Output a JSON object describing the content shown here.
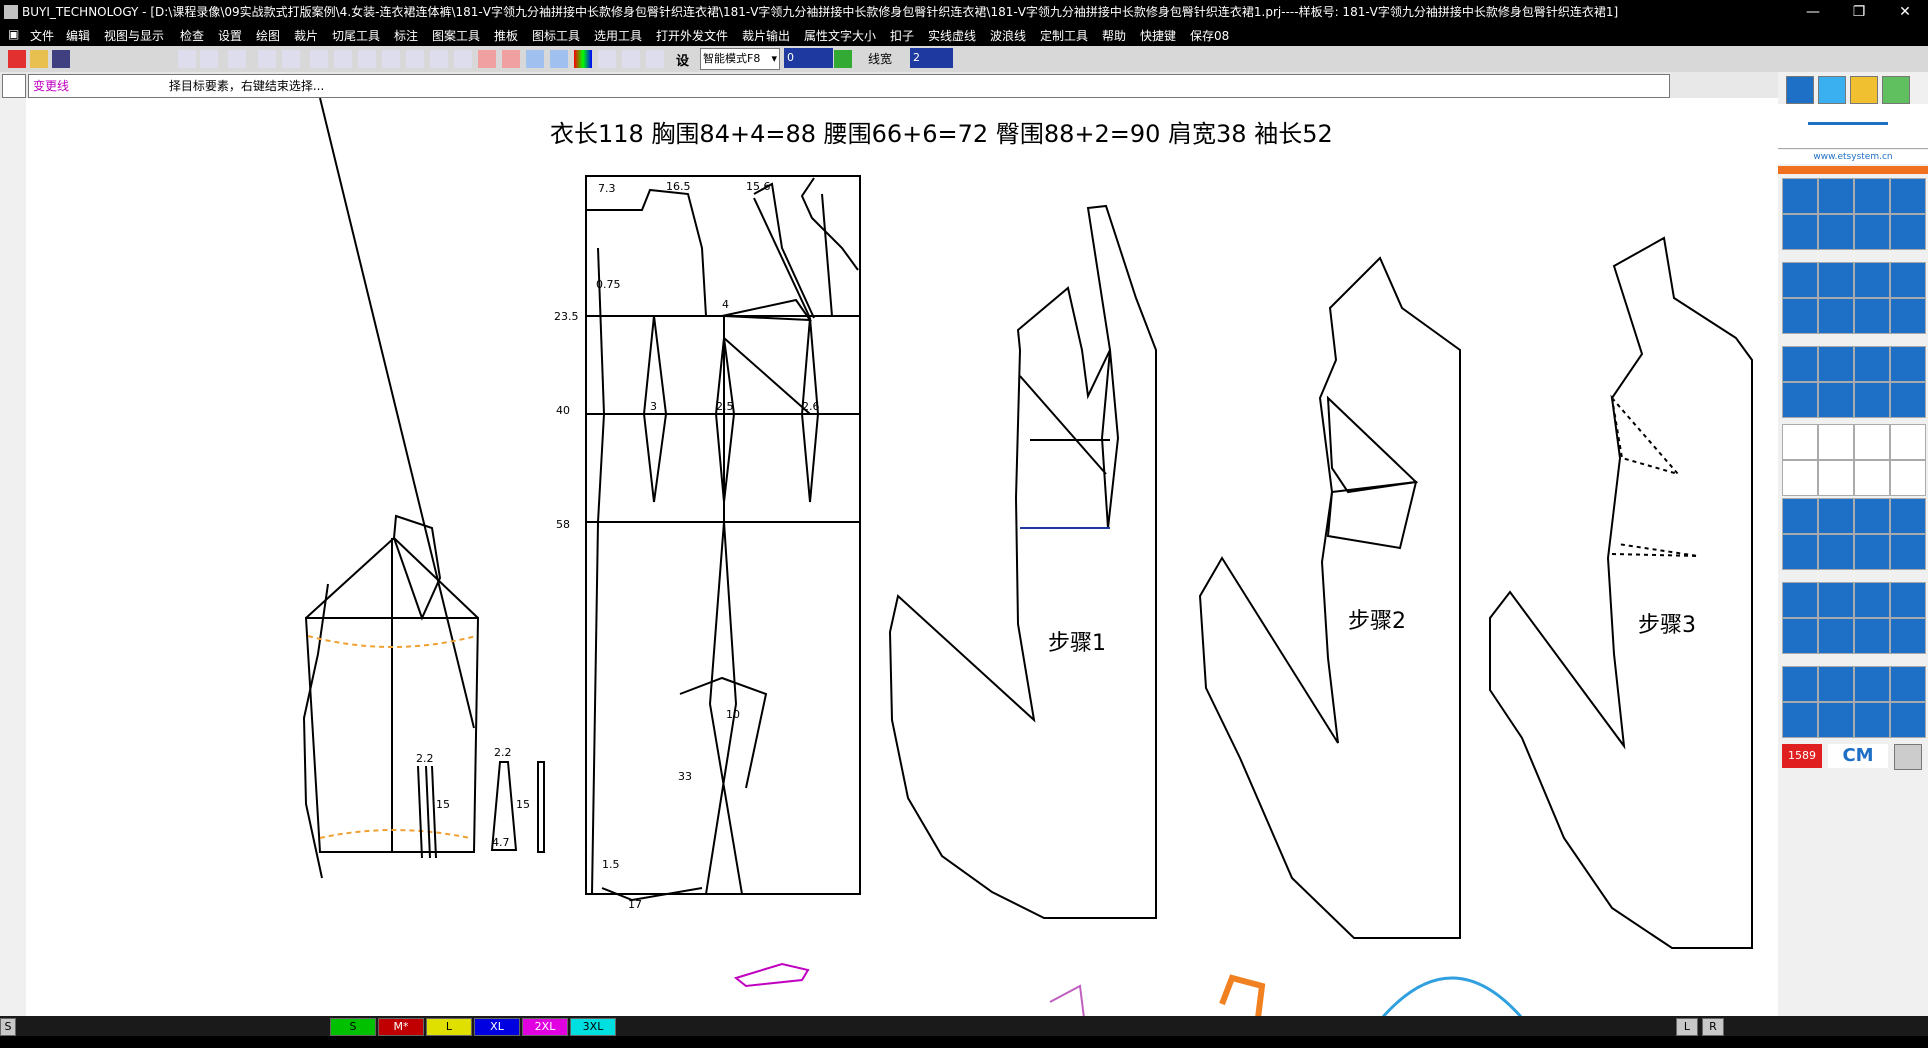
{
  "window": {
    "title": "BUYI_TECHNOLOGY - [D:\\课程录像\\09实战款式打版案例\\4.女装-连衣裙连体裤\\181-V字领九分袖拼接中长款修身包臀针织连衣裙\\181-V字领九分袖拼接中长款修身包臀针织连衣裙\\181-V字领九分袖拼接中长款修身包臀针织连衣裙1.prj----样板号: 181-V字领九分袖拼接中长款修身包臀针织连衣裙1]",
    "minimize": "—",
    "restore": "❐",
    "close": "✕"
  },
  "menu": [
    "文件",
    "编辑",
    "视图与显示",
    "检查",
    "设置",
    "绘图",
    "裁片",
    "切尾工具",
    "标注",
    "图案工具",
    "推板",
    "图标工具",
    "选用工具",
    "打开外发文件",
    "裁片输出",
    "属性文字大小",
    "扣子",
    "实线虚线",
    "波浪线",
    "定制工具",
    "帮助",
    "快捷键",
    "保存08"
  ],
  "toolbar": {
    "mode_select": "智能模式F8",
    "value_input": "0",
    "line_width_label": "线宽",
    "line_width_value": "2"
  },
  "command": {
    "mode": "变更线",
    "prompt": "择目标要素，右键结束选择..."
  },
  "panel": {
    "website": "www.etsystem.cn",
    "counter": "1589",
    "unit": "CM"
  },
  "drawing": {
    "header": "衣长118  胸围84+4=88  腰围66+6=72  臀围88+2=90  肩宽38  袖长52",
    "step1": "步骤1",
    "step2": "步骤2",
    "step3": "步骤3",
    "dims": {
      "d73": "7.3",
      "d165": "16.5",
      "d156": "15.6",
      "d075": "0.75",
      "d235": "23.5",
      "d40": "40",
      "d58": "58",
      "d3": "3",
      "d25": "2.5",
      "d26": "2.6",
      "d4": "4",
      "d10": "10",
      "d33": "33",
      "d15a": "1.5",
      "d17": "17",
      "d22a": "2.2",
      "d22b": "2.2",
      "d15b": "15",
      "d15c": "15",
      "d47": "4.7"
    }
  },
  "size_tabs": [
    "S",
    "M*",
    "L",
    "XL",
    "2XL",
    "3XL"
  ],
  "size_colors": [
    "#00ff00",
    "#ff0000",
    "#ffff00",
    "#0000ff",
    "#ff00ff",
    "#00ffff"
  ],
  "bottom_right": [
    "L",
    "R"
  ]
}
